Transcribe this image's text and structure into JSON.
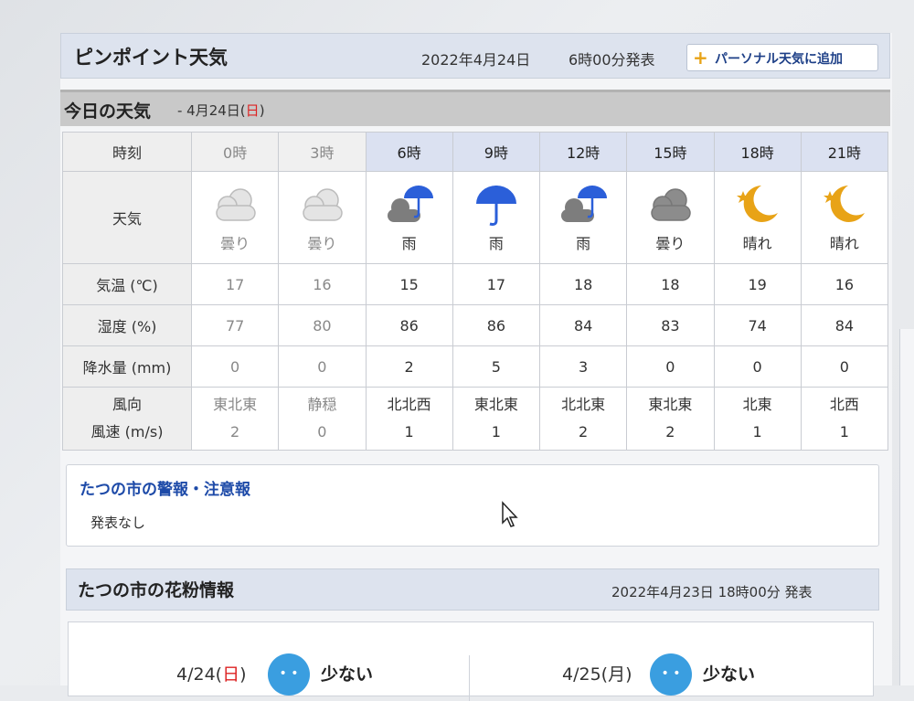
{
  "header": {
    "title": "ピンポイント天気",
    "date": "2022年4月24日",
    "time": "6時00分発表",
    "add_button": "パーソナル天気に追加"
  },
  "today": {
    "title": "今日の天気",
    "date_prefix": "- 4月24日(",
    "weekday": "日",
    "date_suffix": ")"
  },
  "table": {
    "row_labels": {
      "time": "時刻",
      "weather": "天気",
      "temp": "気温 (℃)",
      "humidity": "湿度 (%)",
      "precip": "降水量 (mm)",
      "wind_dir": "風向",
      "wind_speed": "風速 (m/s)"
    },
    "columns": [
      {
        "time": "0時",
        "weather": "曇り",
        "icon": "cloud-icon",
        "temp": "17",
        "humidity": "77",
        "precip": "0",
        "wind_dir": "東北東",
        "wind_speed": "2",
        "past": true
      },
      {
        "time": "3時",
        "weather": "曇り",
        "icon": "cloud-icon",
        "temp": "16",
        "humidity": "80",
        "precip": "0",
        "wind_dir": "静穏",
        "wind_speed": "0",
        "past": true
      },
      {
        "time": "6時",
        "weather": "雨",
        "icon": "cloud-umbrella-icon",
        "temp": "15",
        "humidity": "86",
        "precip": "2",
        "wind_dir": "北北西",
        "wind_speed": "1",
        "past": false
      },
      {
        "time": "9時",
        "weather": "雨",
        "icon": "umbrella-icon",
        "temp": "17",
        "humidity": "86",
        "precip": "5",
        "wind_dir": "東北東",
        "wind_speed": "1",
        "past": false
      },
      {
        "time": "12時",
        "weather": "雨",
        "icon": "cloud-umbrella-icon",
        "temp": "18",
        "humidity": "84",
        "precip": "3",
        "wind_dir": "北北東",
        "wind_speed": "2",
        "past": false
      },
      {
        "time": "15時",
        "weather": "曇り",
        "icon": "cloud-icon",
        "temp": "18",
        "humidity": "83",
        "precip": "0",
        "wind_dir": "東北東",
        "wind_speed": "2",
        "past": false
      },
      {
        "time": "18時",
        "weather": "晴れ",
        "icon": "moon-star-icon",
        "temp": "19",
        "humidity": "74",
        "precip": "0",
        "wind_dir": "北東",
        "wind_speed": "1",
        "past": false
      },
      {
        "time": "21時",
        "weather": "晴れ",
        "icon": "moon-star-icon",
        "temp": "16",
        "humidity": "84",
        "precip": "0",
        "wind_dir": "北西",
        "wind_speed": "1",
        "past": false
      }
    ]
  },
  "warning": {
    "title": "たつの市の警報・注意報",
    "text": "発表なし"
  },
  "pollen": {
    "title": "たつの市の花粉情報",
    "published": "2022年4月23日 18時00分 発表",
    "days": [
      {
        "date_prefix": "4/24(",
        "weekday": "日",
        "date_suffix": ")",
        "level": "少ない"
      },
      {
        "date_prefix": "4/25(",
        "weekday": "月",
        "date_suffix": ")",
        "level": "少ない"
      }
    ]
  },
  "colors": {
    "accent_blue": "#1d4aa8",
    "umbrella_blue": "#2b5fd9",
    "moon_yellow": "#e8a317",
    "sunday_red": "#dd2222",
    "pollen_face": "#3a9ee0"
  }
}
